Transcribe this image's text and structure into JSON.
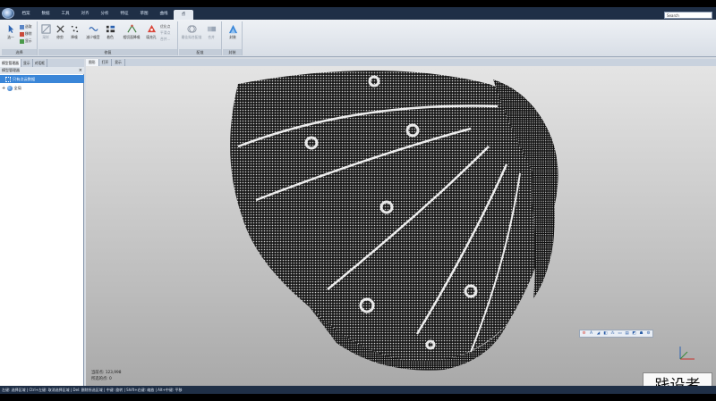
{
  "ribbon_tabs": [
    "档案",
    "数据",
    "工具",
    "对齐",
    "分析",
    "特征",
    "草图",
    "曲线",
    "点"
  ],
  "active_tab_index": 8,
  "search": {
    "value": "Search"
  },
  "ribbon": {
    "group1": {
      "title": "选择",
      "buttons": [
        "选一",
        "选取",
        "移除",
        "显示"
      ]
    },
    "group2": {
      "title": "修复",
      "buttons": [
        "采样",
        "修剪",
        "降噪",
        "减少噪音",
        "着色",
        "相切面降噪",
        "填充孔"
      ],
      "small": [
        "优化点",
        "平滑点",
        "合并..."
      ]
    },
    "group3": {
      "title": "配准",
      "buttons": [
        "最佳拟合配准",
        "合并"
      ]
    },
    "group4": {
      "title": "封装",
      "buttons": [
        "封装"
      ]
    }
  },
  "left_panel": {
    "tabs": [
      "模型管理器",
      "显示",
      "对话框"
    ],
    "title": "模型管理器",
    "tree": [
      {
        "label": "只有点云数据",
        "selected": true
      },
      {
        "label": "全局",
        "selected": false
      }
    ]
  },
  "view_tabs": [
    "图形",
    "打开",
    "显示"
  ],
  "viewport": {
    "point_count": "当前点: 123,998",
    "selected_count": "所选的点: 0"
  },
  "mini_toolbar": [
    "⚙",
    "A",
    "◢",
    "◧",
    "⁂",
    "▭",
    "▤",
    "◩",
    "☗",
    "⚙"
  ],
  "watermark": "践设者",
  "status": "左键: 选择区域 | Ctrl+左键: 取消选择区域 | Del: 删除所选区域 | 中键: 旋转 | Shift+右键: 缩放 | Alt+中键: 平移",
  "colors": {
    "title_bar": "#1f2f46",
    "selection": "#3a86d8",
    "ribbon": "#e4e9f0"
  }
}
